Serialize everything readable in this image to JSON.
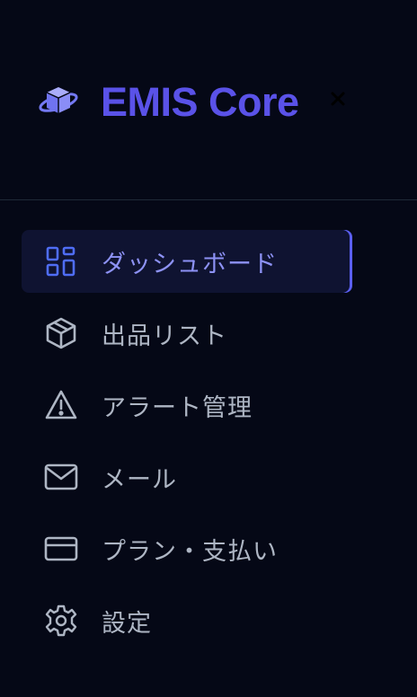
{
  "brand": {
    "logo_icon": "cube-orbit-icon",
    "title": "EMIS Core",
    "title_color": "#5a52e8"
  },
  "header": {
    "close_icon": "close-icon"
  },
  "nav": {
    "items": [
      {
        "label": "ダッシュボード",
        "icon": "dashboard-grid-icon",
        "active": true
      },
      {
        "label": "出品リスト",
        "icon": "cube-icon",
        "active": false
      },
      {
        "label": "アラート管理",
        "icon": "warning-triangle-icon",
        "active": false
      },
      {
        "label": "メール",
        "icon": "mail-icon",
        "active": false
      },
      {
        "label": "プラン・支払い",
        "icon": "credit-card-icon",
        "active": false
      },
      {
        "label": "設定",
        "icon": "gear-icon",
        "active": false
      }
    ]
  },
  "colors": {
    "background": "#050816",
    "accent": "#5b5ff0",
    "active_bg": "#0f1331",
    "text_muted": "#aeb6c4",
    "divider": "#1f2937"
  }
}
